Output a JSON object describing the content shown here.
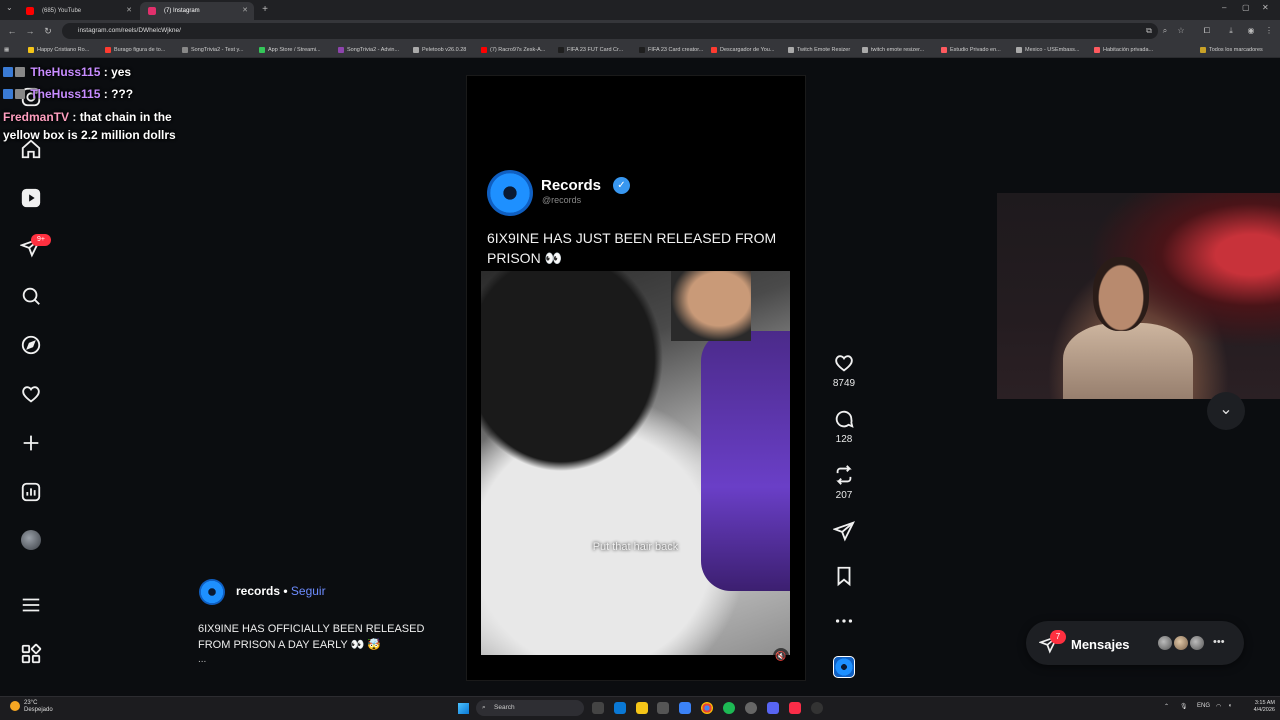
{
  "browser": {
    "tabs": [
      {
        "label": "(685) YouTube",
        "color": "#ff0000"
      },
      {
        "label": "(7) Instagram",
        "color": "#e1306c"
      }
    ],
    "url": "instagram.com/reels/DWhelcWjkne/",
    "bookmarks": [
      {
        "label": "Happy Cristiano Ro...",
        "color": "#f5c518"
      },
      {
        "label": "Burago figura de to...",
        "color": "#ff3b30"
      },
      {
        "label": "SongTrivia2 - Test y...",
        "color": "#888888"
      },
      {
        "label": "App Store / Streami...",
        "color": "#34c759"
      },
      {
        "label": "SongTrivia2 - Advin...",
        "color": "#8e44ad"
      },
      {
        "label": "Peletoob v26.0.28",
        "color": "#aaaaaa"
      },
      {
        "label": "(7) Racro97s Zesk-A...",
        "color": "#ff0000"
      },
      {
        "label": "FIFA 23 FUT Card Cr...",
        "color": "#1e1e1e"
      },
      {
        "label": "FIFA 23 Card creator...",
        "color": "#1e1e1e"
      },
      {
        "label": "Descargador de You...",
        "color": "#ff3b30"
      },
      {
        "label": "Twitch Emote Resizer",
        "color": "#aaaaaa"
      },
      {
        "label": "twitch emote resizer...",
        "color": "#aaaaaa"
      },
      {
        "label": "Estudio Privado en...",
        "color": "#ff5a5f"
      },
      {
        "label": "Mexico - USEmbass...",
        "color": "#aaaaaa"
      },
      {
        "label": "Habitación privada...",
        "color": "#ff5a5f"
      }
    ],
    "all_bookmarks": "Todos los marcadores"
  },
  "chat": [
    {
      "user": "TheHuss115",
      "msg": "yes"
    },
    {
      "user": "TheHuss115",
      "msg": "???"
    },
    {
      "user": "FredmanTV",
      "msg": "that chain in the yellow box is 2.2 million dollrs"
    }
  ],
  "sidebar": {
    "icons": [
      "home-icon",
      "reels-icon",
      "direct-icon",
      "search-icon",
      "explore-icon",
      "heart-icon",
      "create-icon",
      "dashboard-icon",
      "profile-avatar",
      "menu-icon",
      "apps-icon"
    ],
    "notification_badge": "9+"
  },
  "reel": {
    "account_name": "Records",
    "handle": "@records",
    "headline": "6IX9INE HAS JUST BEEN RELEASED FROM PRISON 👀",
    "video_caption": "Put that hair back"
  },
  "actions": {
    "likes": "8749",
    "comments": "128",
    "reposts": "207"
  },
  "post": {
    "username": "records",
    "separator": " • ",
    "follow_label": "Seguir",
    "caption": "6IX9INE HAS OFFICIALLY BEEN RELEASED FROM PRISON A DAY EARLY 👀 🤯",
    "more": "..."
  },
  "messages": {
    "label": "Mensajes",
    "badge": "7"
  },
  "taskbar": {
    "weather_temp": "23°C",
    "weather_desc": "Despejado",
    "search_label": "Search",
    "lang": "ENG",
    "time": "3:15 AM",
    "date": "4/4/2026"
  },
  "colors": {
    "accent_blue": "#3897f0",
    "follow_blue": "#6d8cff",
    "notification_red": "#ff3040",
    "page_bg": "#0b0d10"
  }
}
